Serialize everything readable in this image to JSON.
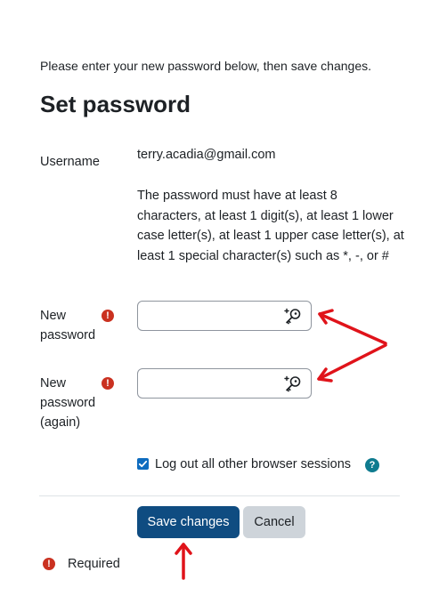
{
  "intro_text": "Please enter your new password below, then save changes.",
  "title": "Set password",
  "username": {
    "label": "Username",
    "value": "terry.acadia@gmail.com"
  },
  "password_policy": "The password must have at least 8 characters, at least 1 digit(s), at least 1 lower case letter(s), at least 1 upper case letter(s), at least 1 special character(s) such as *, -, or #",
  "new_password": {
    "label_line1": "New",
    "label_line2": "password",
    "value": "",
    "icon": "key-icon"
  },
  "new_password_again": {
    "label_line1": "New",
    "label_line2": "password",
    "label_line3": "(again)",
    "value": "",
    "icon": "key-icon"
  },
  "required_icon": "!",
  "logout_checkbox": {
    "label": "Log out all other browser sessions",
    "checked": true,
    "help_icon": "?"
  },
  "buttons": {
    "save": "Save changes",
    "cancel": "Cancel"
  },
  "required_legend": "Required",
  "colors": {
    "primary": "#0f4c81",
    "secondary": "#ced4da",
    "required": "#ca3120",
    "help": "#0f7b8f",
    "annotation_arrow": "#e0131a"
  }
}
